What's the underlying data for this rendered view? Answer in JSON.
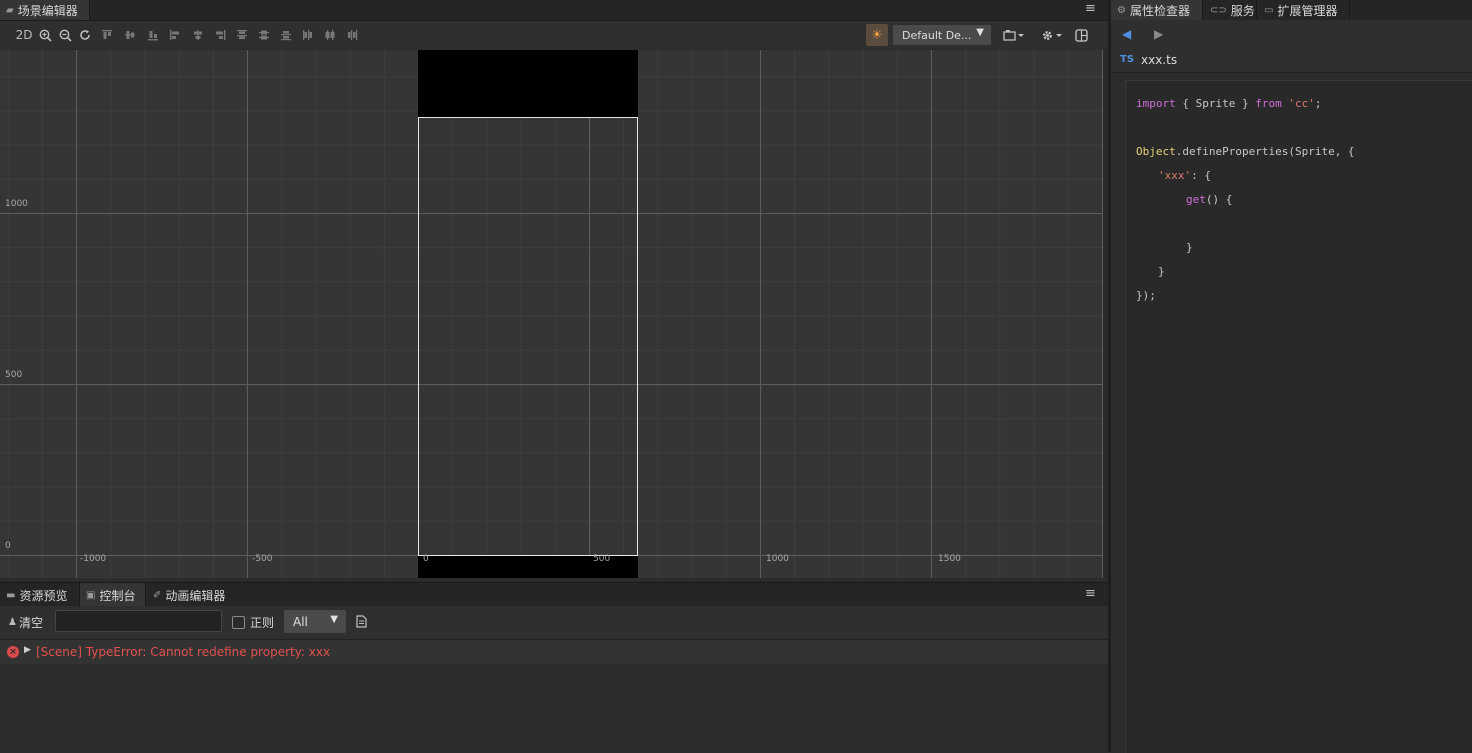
{
  "scene_panel": {
    "tab_label": "场景编辑器",
    "toolbar": {
      "mode_2d": "2D",
      "device": "Default De...",
      "colors": {
        "light_accent": "#f0a040"
      }
    },
    "ruler_labels_y": [
      "1000",
      "500",
      "0"
    ],
    "ruler_labels_x": [
      "-1000",
      "-500",
      "0",
      "500",
      "1000",
      "1500"
    ]
  },
  "bottom_panel": {
    "tabs": [
      {
        "label": "资源预览"
      },
      {
        "label": "控制台"
      },
      {
        "label": "动画编辑器"
      }
    ],
    "clear_label": "清空",
    "search_value": "",
    "regex_label": "正则",
    "filter_value": "All",
    "messages": [
      {
        "level": "error",
        "text": "[Scene] TypeError: Cannot redefine property: xxx"
      }
    ],
    "colors": {
      "error": "#e0514f"
    }
  },
  "right_panel": {
    "tabs": [
      {
        "label": "属性检查器"
      },
      {
        "label": "服务"
      },
      {
        "label": "扩展管理器"
      }
    ],
    "file_badge": "TS",
    "file_name": "xxx.ts",
    "code": {
      "l1": {
        "a": "import",
        "b": " { Sprite } ",
        "c": "from",
        "d": " 'cc'",
        "e": ";"
      },
      "l2": {
        "a": "Object",
        "b": ".defineProperties(Sprite, {"
      },
      "l3": {
        "a": "'xxx'",
        "b": ": {"
      },
      "l4": {
        "a": "get",
        "b": "() {"
      },
      "l5": "}",
      "l6": "}",
      "l7": "});"
    }
  }
}
